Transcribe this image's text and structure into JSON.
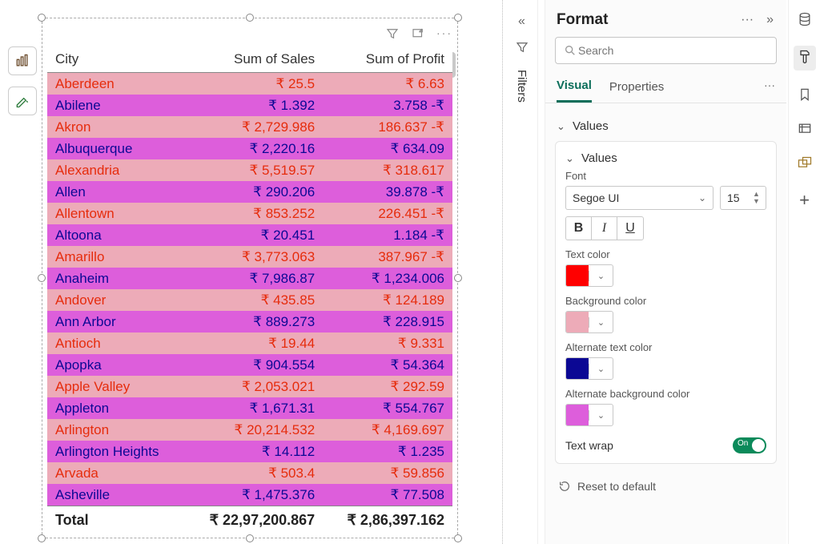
{
  "table": {
    "columns": [
      "City",
      "Sum of Sales",
      "Sum of Profit"
    ],
    "rows": [
      {
        "city": "Aberdeen",
        "sales": "₹ 25.5",
        "profit": "₹ 6.63"
      },
      {
        "city": "Abilene",
        "sales": "₹ 1.392",
        "profit": "3.758 -₹"
      },
      {
        "city": "Akron",
        "sales": "₹ 2,729.986",
        "profit": "186.637 -₹"
      },
      {
        "city": "Albuquerque",
        "sales": "₹ 2,220.16",
        "profit": "₹ 634.09"
      },
      {
        "city": "Alexandria",
        "sales": "₹ 5,519.57",
        "profit": "₹ 318.617"
      },
      {
        "city": "Allen",
        "sales": "₹ 290.206",
        "profit": "39.878 -₹"
      },
      {
        "city": "Allentown",
        "sales": "₹ 853.252",
        "profit": "226.451 -₹"
      },
      {
        "city": "Altoona",
        "sales": "₹ 20.451",
        "profit": "1.184 -₹"
      },
      {
        "city": "Amarillo",
        "sales": "₹ 3,773.063",
        "profit": "387.967 -₹"
      },
      {
        "city": "Anaheim",
        "sales": "₹ 7,986.87",
        "profit": "₹ 1,234.006"
      },
      {
        "city": "Andover",
        "sales": "₹ 435.85",
        "profit": "₹ 124.189"
      },
      {
        "city": "Ann Arbor",
        "sales": "₹ 889.273",
        "profit": "₹ 228.915"
      },
      {
        "city": "Antioch",
        "sales": "₹ 19.44",
        "profit": "₹ 9.331"
      },
      {
        "city": "Apopka",
        "sales": "₹ 904.554",
        "profit": "₹ 54.364"
      },
      {
        "city": "Apple Valley",
        "sales": "₹ 2,053.021",
        "profit": "₹ 292.59"
      },
      {
        "city": "Appleton",
        "sales": "₹ 1,671.31",
        "profit": "₹ 554.767"
      },
      {
        "city": "Arlington",
        "sales": "₹ 20,214.532",
        "profit": "₹ 4,169.697"
      },
      {
        "city": "Arlington Heights",
        "sales": "₹ 14.112",
        "profit": "₹ 1.235"
      },
      {
        "city": "Arvada",
        "sales": "₹ 503.4",
        "profit": "₹ 59.856"
      },
      {
        "city": "Asheville",
        "sales": "₹ 1,475.376",
        "profit": "₹ 77.508"
      }
    ],
    "total": {
      "label": "Total",
      "sales": "₹ 22,97,200.867",
      "profit": "₹ 2,86,397.162"
    }
  },
  "filters": {
    "label": "Filters"
  },
  "format": {
    "title": "Format",
    "search_placeholder": "Search",
    "tabs": {
      "visual": "Visual",
      "properties": "Properties"
    },
    "outer_values": "Values",
    "values_card": {
      "header": "Values",
      "font_label": "Font",
      "font_name": "Segoe UI",
      "font_size": "15",
      "text_color_label": "Text color",
      "text_color": "#ff0000",
      "bg_color_label": "Background color",
      "bg_color": "#edabb8",
      "alt_text_color_label": "Alternate text color",
      "alt_text_color": "#0b0894",
      "alt_bg_color_label": "Alternate background color",
      "alt_bg_color": "#dd5edb",
      "text_wrap_label": "Text wrap",
      "text_wrap_on": "On"
    },
    "reset": "Reset to default"
  },
  "biu": {
    "b": "B",
    "i": "I",
    "u": "U"
  }
}
